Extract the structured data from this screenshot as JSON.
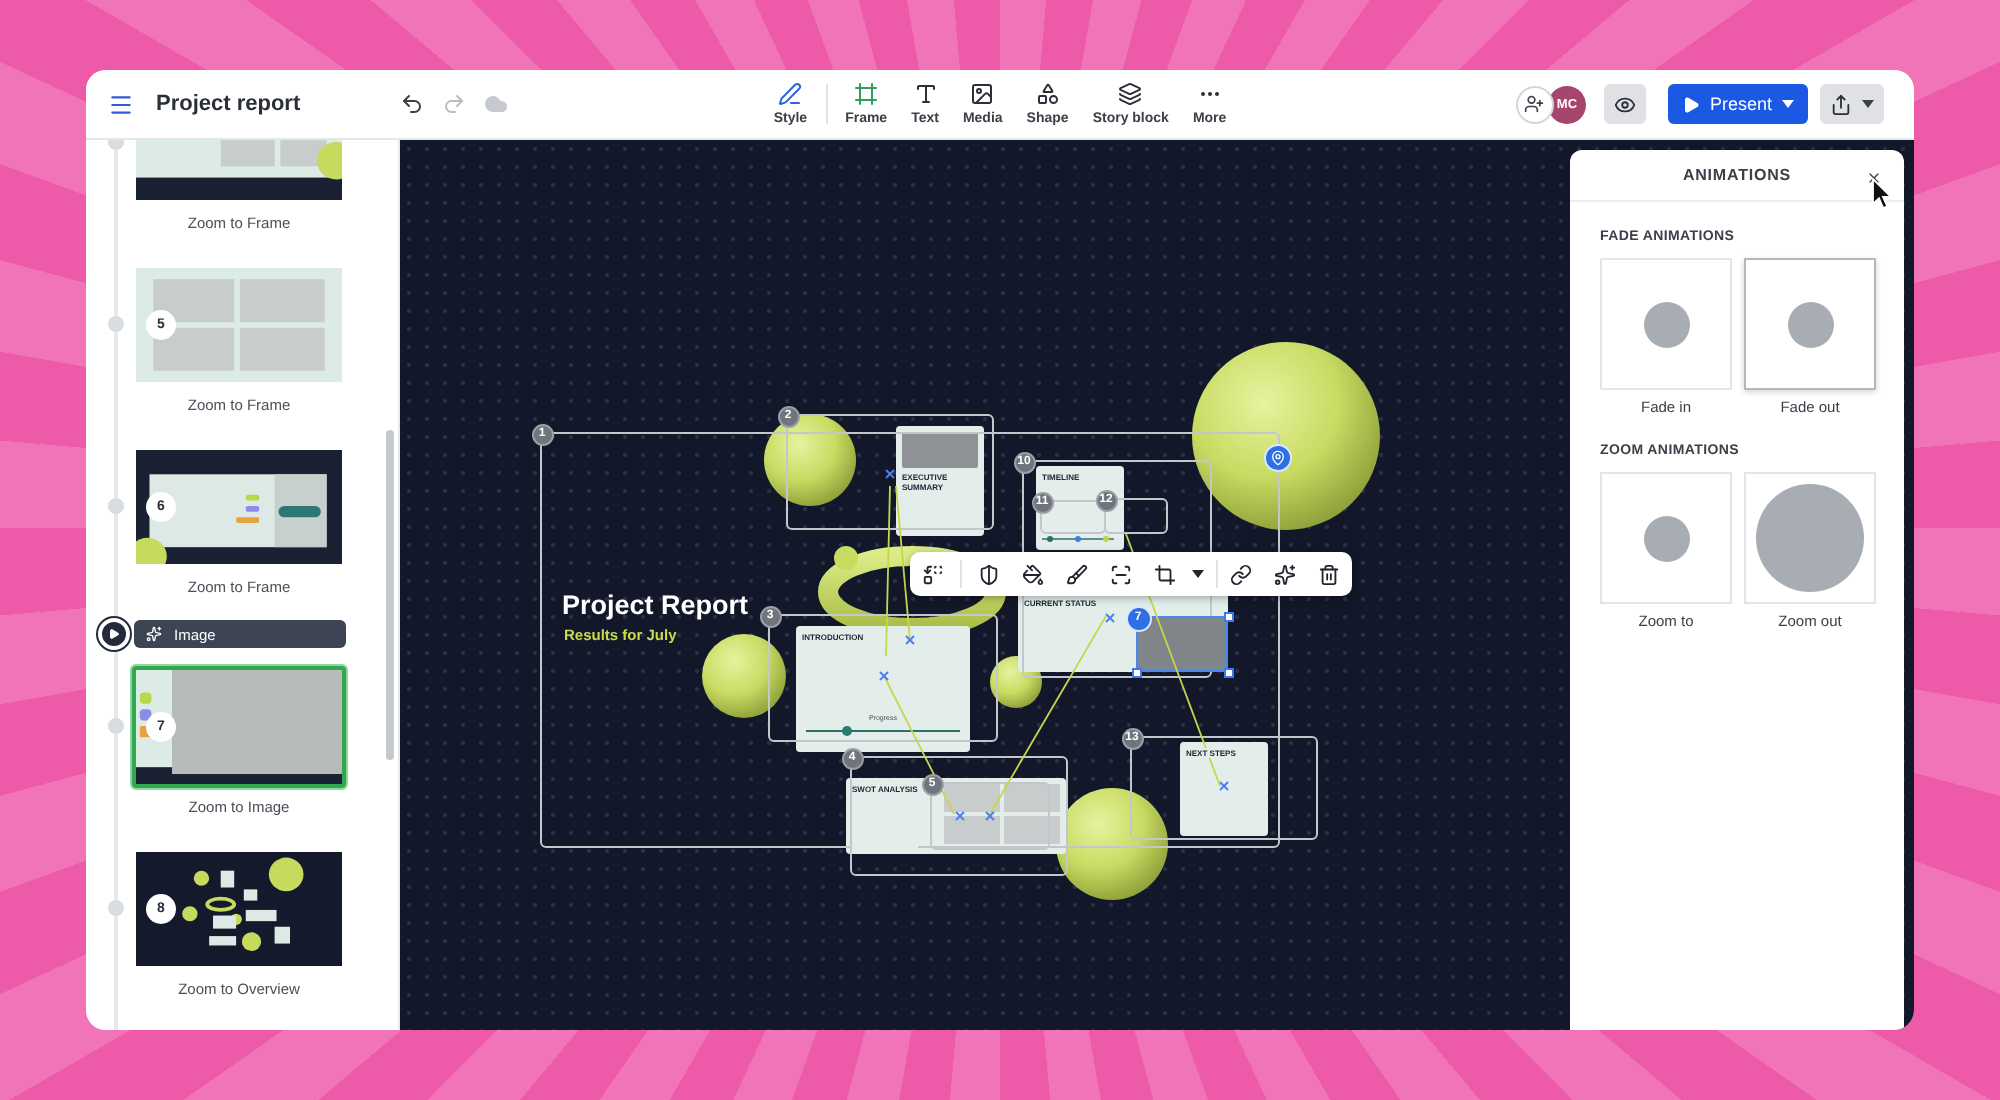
{
  "window": {
    "title": "Project report"
  },
  "history": [
    {
      "kind": "undo",
      "disabled": false
    },
    {
      "kind": "redo",
      "disabled": true
    }
  ],
  "tools": [
    {
      "kind": "style",
      "label": "Style"
    },
    {
      "kind": "frame",
      "label": "Frame"
    },
    {
      "kind": "text",
      "label": "Text"
    },
    {
      "kind": "media",
      "label": "Media"
    },
    {
      "kind": "shape",
      "label": "Shape"
    },
    {
      "kind": "story",
      "label": "Story block"
    },
    {
      "kind": "more",
      "label": "More"
    }
  ],
  "collaborators": [
    {
      "initials": "MC"
    }
  ],
  "present_button": {
    "label": "Present"
  },
  "sidebar": {
    "items": [
      {
        "kind": "slide",
        "label": "Zoom to Frame",
        "thumbnail": {
          "kind": "light"
        },
        "selected": false
      },
      {
        "kind": "slide",
        "number": "5",
        "label": "Zoom to Frame",
        "thumbnail": {
          "kind": "grid"
        },
        "selected": false
      },
      {
        "kind": "slide",
        "number": "6",
        "label": "Zoom to Frame",
        "thumbnail": {
          "kind": "dark"
        },
        "selected": false
      },
      {
        "kind": "object",
        "label": "Image"
      },
      {
        "kind": "slide",
        "number": "7",
        "label": "Zoom to Image",
        "thumbnail": {
          "kind": "photo"
        },
        "selected": true
      },
      {
        "kind": "slide",
        "number": "8",
        "label": "Zoom to Overview",
        "thumbnail": {
          "kind": "overview"
        },
        "selected": false
      }
    ]
  },
  "canvas": {
    "title": "Project Report",
    "subtitle": "Results for July",
    "frames": [
      {
        "number": "1",
        "kind": "frame",
        "selected": false
      },
      {
        "number": "2",
        "kind": "frame",
        "selected": false
      },
      {
        "number": "3",
        "kind": "frame",
        "selected": false
      },
      {
        "number": "4",
        "kind": "frame",
        "selected": false
      },
      {
        "number": "5",
        "kind": "frame",
        "selected": false
      },
      {
        "number": "7",
        "kind": "image",
        "selected": true
      },
      {
        "number": "10",
        "kind": "frame",
        "selected": false
      },
      {
        "number": "11",
        "kind": "frame",
        "selected": false
      },
      {
        "number": "12",
        "kind": "frame",
        "selected": false
      },
      {
        "number": "13",
        "kind": "frame",
        "selected": false
      }
    ],
    "cards": [
      {
        "kind": "image",
        "heading": "EXECUTIVE SUMMARY"
      },
      {
        "kind": "timeline",
        "heading": "TIMELINE"
      },
      {
        "kind": "slider",
        "heading": "INTRODUCTION",
        "slider_label": "Progress",
        "level": 0.26
      },
      {
        "kind": "status",
        "heading": "CURRENT STATUS"
      },
      {
        "kind": "grid",
        "heading": "SWOT ANALYSIS"
      },
      {
        "kind": "text",
        "heading": "NEXT STEPS"
      }
    ]
  },
  "animations_panel": {
    "title": "ANIMATIONS",
    "sections": [
      {
        "heading": "FADE ANIMATIONS",
        "options": [
          {
            "label": "Fade in",
            "kind": "fade",
            "selected": false
          },
          {
            "label": "Fade out",
            "kind": "fade",
            "selected": true
          }
        ]
      },
      {
        "heading": "ZOOM ANIMATIONS",
        "options": [
          {
            "label": "Zoom to",
            "kind": "zoom-in",
            "selected": false
          },
          {
            "label": "Zoom out",
            "kind": "zoom-out",
            "selected": false
          }
        ]
      }
    ]
  }
}
